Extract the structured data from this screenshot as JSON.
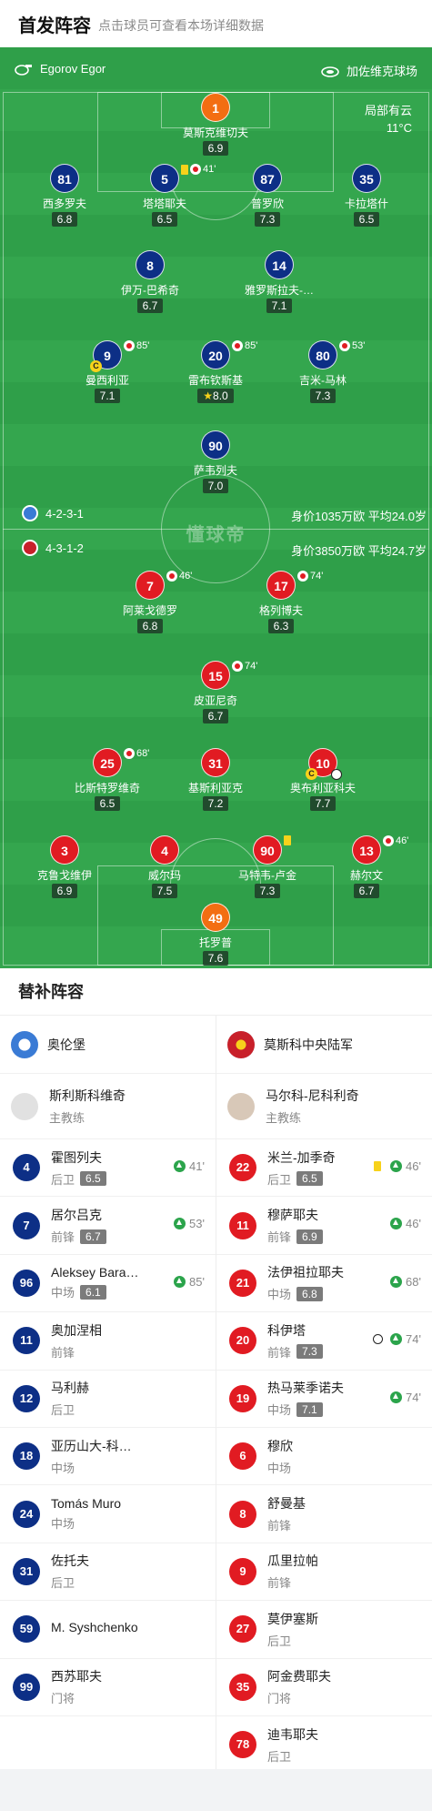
{
  "header": {
    "title": "首发阵容",
    "subtitle": "点击球员可查看本场详细数据"
  },
  "pitch": {
    "referee": "Egorov Egor",
    "venue": "加佐维克球场",
    "weather": "局部有云",
    "temperature": "11°C",
    "watermark": "懂球帝",
    "home_formation": "4-2-3-1",
    "home_value": "身价1035万欧 平均24.0岁",
    "away_formation": "4-3-1-2",
    "away_value": "身价3850万欧 平均24.7岁"
  },
  "home_players": [
    {
      "num": "1",
      "name": "莫斯克维切夫",
      "rating": "6.9"
    },
    {
      "num": "81",
      "name": "西多罗夫",
      "rating": "6.8"
    },
    {
      "num": "5",
      "name": "塔塔耶夫",
      "rating": "6.5",
      "event": "41'"
    },
    {
      "num": "87",
      "name": "普罗欣",
      "rating": "7.3"
    },
    {
      "num": "35",
      "name": "卡拉塔什",
      "rating": "6.5"
    },
    {
      "num": "8",
      "name": "伊万-巴希奇",
      "rating": "6.7"
    },
    {
      "num": "14",
      "name": "雅罗斯拉夫-…",
      "rating": "7.1"
    },
    {
      "num": "9",
      "name": "曼西利亚",
      "rating": "7.1",
      "event": "85'"
    },
    {
      "num": "20",
      "name": "雷布钦斯基",
      "rating": "8.0",
      "event": "85'"
    },
    {
      "num": "80",
      "name": "吉米-马林",
      "rating": "7.3",
      "event": "53'"
    },
    {
      "num": "90",
      "name": "萨韦列夫",
      "rating": "7.0"
    }
  ],
  "away_players": [
    {
      "num": "7",
      "name": "阿莱戈德罗",
      "rating": "6.8",
      "event": "46'"
    },
    {
      "num": "17",
      "name": "格列博夫",
      "rating": "6.3",
      "event": "74'"
    },
    {
      "num": "15",
      "name": "皮亚尼奇",
      "rating": "6.7",
      "event": "74'"
    },
    {
      "num": "25",
      "name": "比斯特罗维奇",
      "rating": "6.5",
      "event": "68'"
    },
    {
      "num": "31",
      "name": "基斯利亚克",
      "rating": "7.2"
    },
    {
      "num": "10",
      "name": "奥布利亚科夫",
      "rating": "7.7"
    },
    {
      "num": "3",
      "name": "克鲁戈维伊",
      "rating": "6.9"
    },
    {
      "num": "4",
      "name": "威尔玛",
      "rating": "7.5"
    },
    {
      "num": "90",
      "name": "马特韦-卢金",
      "rating": "7.3"
    },
    {
      "num": "13",
      "name": "赫尔文",
      "rating": "6.7",
      "event": "46'"
    },
    {
      "num": "49",
      "name": "托罗普",
      "rating": "7.6"
    }
  ],
  "subs": {
    "title": "替补阵容",
    "home_team": "奥伦堡",
    "away_team": "莫斯科中央陆军",
    "home_coach": {
      "name": "斯利斯科维奇",
      "role": "主教练"
    },
    "away_coach": {
      "name": "马尔科-尼科利奇",
      "role": "主教练"
    },
    "home": [
      {
        "num": "4",
        "name": "霍图列夫",
        "pos": "后卫",
        "rating": "6.5",
        "event": "41'"
      },
      {
        "num": "7",
        "name": "居尔吕克",
        "pos": "前锋",
        "rating": "6.7",
        "event": "53'"
      },
      {
        "num": "96",
        "name": "Aleksey Bara…",
        "pos": "中场",
        "rating": "6.1",
        "event": "85'"
      },
      {
        "num": "11",
        "name": "奥加涅相",
        "pos": "前锋"
      },
      {
        "num": "12",
        "name": "马利赫",
        "pos": "后卫"
      },
      {
        "num": "18",
        "name": "亚历山大-科…",
        "pos": "中场"
      },
      {
        "num": "24",
        "name": "Tomás Muro",
        "pos": "中场"
      },
      {
        "num": "31",
        "name": "佐托夫",
        "pos": "后卫"
      },
      {
        "num": "59",
        "name": "M. Syshchenko",
        "pos": ""
      },
      {
        "num": "99",
        "name": "西苏耶夫",
        "pos": "门将"
      }
    ],
    "away": [
      {
        "num": "22",
        "name": "米兰-加季奇",
        "pos": "后卫",
        "rating": "6.5",
        "event": "46'"
      },
      {
        "num": "11",
        "name": "穆萨耶夫",
        "pos": "前锋",
        "rating": "6.9",
        "event": "46'"
      },
      {
        "num": "21",
        "name": "法伊祖拉耶夫",
        "pos": "中场",
        "rating": "6.8",
        "event": "68'"
      },
      {
        "num": "20",
        "name": "科伊塔",
        "pos": "前锋",
        "rating": "7.3",
        "event": "74'"
      },
      {
        "num": "19",
        "name": "热马莱季诺夫",
        "pos": "中场",
        "rating": "7.1",
        "event": "74'"
      },
      {
        "num": "6",
        "name": "穆欣",
        "pos": "中场"
      },
      {
        "num": "8",
        "name": "舒曼基",
        "pos": "前锋"
      },
      {
        "num": "9",
        "name": "瓜里拉帕",
        "pos": "前锋"
      },
      {
        "num": "27",
        "name": "莫伊塞斯",
        "pos": "后卫"
      },
      {
        "num": "35",
        "name": "阿金费耶夫",
        "pos": "门将"
      },
      {
        "num": "78",
        "name": "迪韦耶夫",
        "pos": "后卫"
      }
    ]
  },
  "colors": {
    "home": "#0d2f86",
    "away": "#e11b22",
    "keeper": "#f36e12",
    "pitch": "#2f9f49"
  }
}
